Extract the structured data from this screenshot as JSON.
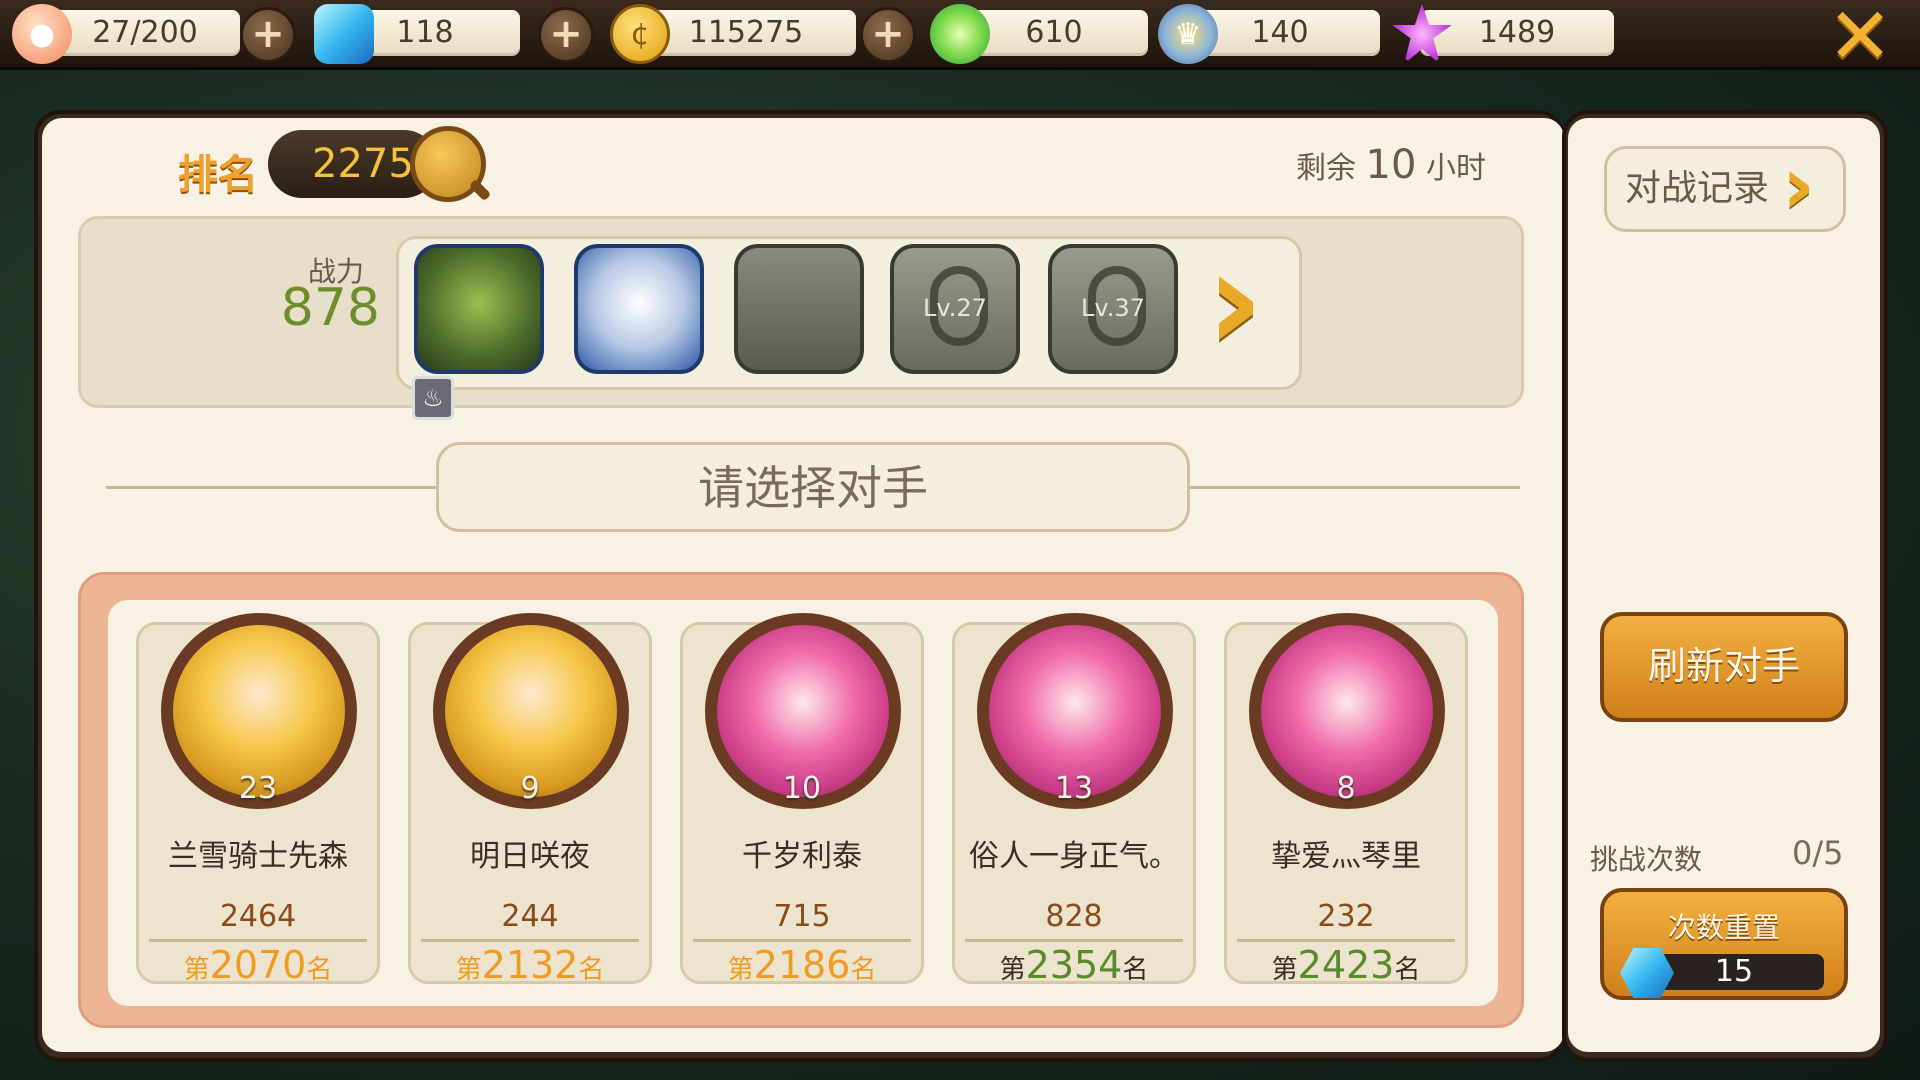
{
  "resources": {
    "stamina": "27/200",
    "gems": "118",
    "gold": "115275",
    "candy": "610",
    "honor": "140",
    "star": "1489"
  },
  "icons": {
    "stamina": "peach-icon",
    "gems": "blue-gem-icon",
    "gold": "gold-coin-icon",
    "candy": "lollipop-icon",
    "honor": "crown-badge-icon",
    "star": "purple-star-icon",
    "close": "close-icon",
    "add": "plus-icon",
    "magnify": "magnifier-icon",
    "next": "chevron-right-icon",
    "fire": "flame-badge-icon",
    "lock": "lock-icon"
  },
  "header": {
    "rank_label": "排名",
    "rank_value": "2275",
    "remain_prefix": "剩余",
    "remain_value": "10",
    "remain_suffix": "小时"
  },
  "formation": {
    "power_label": "战力",
    "power_value": "878",
    "locked_slots": [
      "Lv.27",
      "Lv.37"
    ]
  },
  "select_title": "请选择对手",
  "opponents": [
    {
      "level": "23",
      "name": "兰雪骑士先森",
      "power": "2464",
      "rank_prefix": "第",
      "rank": "2070",
      "rank_suffix": "名"
    },
    {
      "level": "9",
      "name": "明日咲夜",
      "power": "244",
      "rank_prefix": "第",
      "rank": "2132",
      "rank_suffix": "名"
    },
    {
      "level": "10",
      "name": "千岁利泰",
      "power": "715",
      "rank_prefix": "第",
      "rank": "2186",
      "rank_suffix": "名"
    },
    {
      "level": "13",
      "name": "俗人一身正气。",
      "power": "828",
      "rank_prefix": "第",
      "rank": "2354",
      "rank_suffix": "名"
    },
    {
      "level": "8",
      "name": "挚爱灬琴里",
      "power": "232",
      "rank_prefix": "第",
      "rank": "2423",
      "rank_suffix": "名"
    }
  ],
  "side": {
    "record_label": "对战记录",
    "refresh_label": "刷新对手",
    "challenge_label": "挑战次数",
    "challenge_value": "0/5",
    "reset_label": "次数重置",
    "reset_cost": "15"
  },
  "colors": {
    "accent_orange": "#f09a22",
    "power_green": "#6e8e2e",
    "panel_bg": "#f7f2e4",
    "opponent_frame": "#eeb496"
  }
}
